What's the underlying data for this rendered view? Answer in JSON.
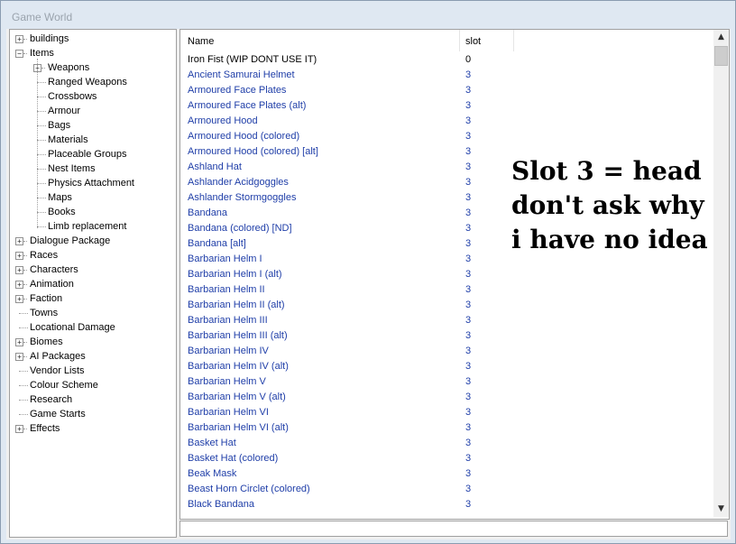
{
  "window": {
    "title": "Game World"
  },
  "tree": [
    {
      "label": "buildings",
      "expander": "+",
      "indent": 0
    },
    {
      "label": "Items",
      "expander": "-",
      "indent": 0
    },
    {
      "label": "Weapons",
      "expander": "+",
      "indent": 1
    },
    {
      "label": "Ranged Weapons",
      "expander": "",
      "indent": 1
    },
    {
      "label": "Crossbows",
      "expander": "",
      "indent": 1
    },
    {
      "label": "Armour",
      "expander": "",
      "indent": 1,
      "selected": true
    },
    {
      "label": "Bags",
      "expander": "",
      "indent": 1
    },
    {
      "label": "Materials",
      "expander": "",
      "indent": 1
    },
    {
      "label": "Placeable Groups",
      "expander": "",
      "indent": 1
    },
    {
      "label": "Nest Items",
      "expander": "",
      "indent": 1
    },
    {
      "label": "Physics Attachment",
      "expander": "",
      "indent": 1
    },
    {
      "label": "Maps",
      "expander": "",
      "indent": 1
    },
    {
      "label": "Books",
      "expander": "",
      "indent": 1
    },
    {
      "label": "Limb replacement",
      "expander": "",
      "indent": 1
    },
    {
      "label": "Dialogue Package",
      "expander": "+",
      "indent": 0
    },
    {
      "label": "Races",
      "expander": "+",
      "indent": 0
    },
    {
      "label": "Characters",
      "expander": "+",
      "indent": 0
    },
    {
      "label": "Animation",
      "expander": "+",
      "indent": 0
    },
    {
      "label": "Faction",
      "expander": "+",
      "indent": 0
    },
    {
      "label": "Towns",
      "expander": "",
      "indent": 0
    },
    {
      "label": "Locational Damage",
      "expander": "",
      "indent": 0
    },
    {
      "label": "Biomes",
      "expander": "+",
      "indent": 0
    },
    {
      "label": "AI Packages",
      "expander": "+",
      "indent": 0
    },
    {
      "label": "Vendor Lists",
      "expander": "",
      "indent": 0
    },
    {
      "label": "Colour Scheme",
      "expander": "",
      "indent": 0
    },
    {
      "label": "Research",
      "expander": "",
      "indent": 0
    },
    {
      "label": "Game Starts",
      "expander": "",
      "indent": 0
    },
    {
      "label": "Effects",
      "expander": "+",
      "indent": 0
    }
  ],
  "list": {
    "columns": {
      "name": "Name",
      "slot": "slot"
    },
    "rows": [
      {
        "name": "Iron Fist (WIP DONT USE IT)",
        "slot": "0"
      },
      {
        "name": "Ancient Samurai Helmet",
        "slot": "3"
      },
      {
        "name": "Armoured Face Plates",
        "slot": "3"
      },
      {
        "name": "Armoured Face Plates (alt)",
        "slot": "3"
      },
      {
        "name": "Armoured Hood",
        "slot": "3"
      },
      {
        "name": "Armoured Hood (colored)",
        "slot": "3"
      },
      {
        "name": "Armoured Hood (colored) [alt]",
        "slot": "3"
      },
      {
        "name": "Ashland Hat",
        "slot": "3"
      },
      {
        "name": "Ashlander Acidgoggles",
        "slot": "3"
      },
      {
        "name": "Ashlander Stormgoggles",
        "slot": "3"
      },
      {
        "name": "Bandana",
        "slot": "3"
      },
      {
        "name": "Bandana (colored) [ND]",
        "slot": "3"
      },
      {
        "name": "Bandana [alt]",
        "slot": "3"
      },
      {
        "name": "Barbarian Helm I",
        "slot": "3"
      },
      {
        "name": "Barbarian Helm I (alt)",
        "slot": "3"
      },
      {
        "name": "Barbarian Helm II",
        "slot": "3"
      },
      {
        "name": "Barbarian Helm II (alt)",
        "slot": "3"
      },
      {
        "name": "Barbarian Helm III",
        "slot": "3"
      },
      {
        "name": "Barbarian Helm III (alt)",
        "slot": "3"
      },
      {
        "name": "Barbarian Helm IV",
        "slot": "3"
      },
      {
        "name": "Barbarian Helm IV (alt)",
        "slot": "3"
      },
      {
        "name": "Barbarian Helm V",
        "slot": "3"
      },
      {
        "name": "Barbarian Helm V (alt)",
        "slot": "3"
      },
      {
        "name": "Barbarian Helm VI",
        "slot": "3"
      },
      {
        "name": "Barbarian Helm VI (alt)",
        "slot": "3"
      },
      {
        "name": "Basket Hat",
        "slot": "3"
      },
      {
        "name": "Basket Hat (colored)",
        "slot": "3"
      },
      {
        "name": "Beak Mask",
        "slot": "3"
      },
      {
        "name": "Beast Horn Circlet (colored)",
        "slot": "3"
      },
      {
        "name": "Black Bandana",
        "slot": "3"
      }
    ]
  },
  "annotation": {
    "lines": [
      "Slot 3 = head",
      "don't ask why",
      "i have no idea"
    ]
  },
  "colors": {
    "link": "#1f3ea8",
    "text": "#000000"
  },
  "scrollbar": {
    "up_icon": "▲",
    "down_icon": "▼"
  }
}
